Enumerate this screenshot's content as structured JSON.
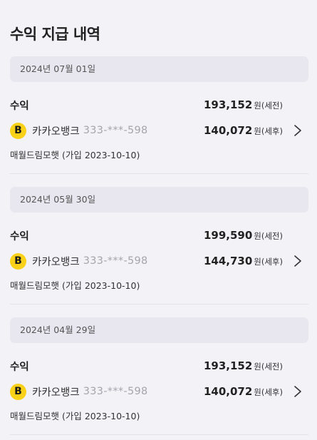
{
  "header": {
    "title": "수익 지급 내역"
  },
  "entries": [
    {
      "date": "2024년 07월 01일",
      "income_label": "수익",
      "pretax_amount": "193,152",
      "pretax_unit": "원(세전)",
      "bank_logo_letter": "B",
      "bank_name": "카카오뱅크",
      "account": "333-***-598",
      "posttax_amount": "140,072",
      "posttax_unit": "원(세후)",
      "plan": "매월드림모햇 (가입 2023-10-10)"
    },
    {
      "date": "2024년 05월 30일",
      "income_label": "수익",
      "pretax_amount": "199,590",
      "pretax_unit": "원(세전)",
      "bank_logo_letter": "B",
      "bank_name": "카카오뱅크",
      "account": "333-***-598",
      "posttax_amount": "144,730",
      "posttax_unit": "원(세후)",
      "plan": "매월드림모햇 (가입 2023-10-10)"
    },
    {
      "date": "2024년 04월 29일",
      "income_label": "수익",
      "pretax_amount": "193,152",
      "pretax_unit": "원(세전)",
      "bank_logo_letter": "B",
      "bank_name": "카카오뱅크",
      "account": "333-***-598",
      "posttax_amount": "140,072",
      "posttax_unit": "원(세후)",
      "plan": "매월드림모햇 (가입 2023-10-10)"
    }
  ],
  "icons": {
    "chevron": "chevron-right-icon",
    "bank_logo": "kakaobank-logo"
  },
  "colors": {
    "background": "#f3f2f7",
    "date_bar": "#e8e7ef",
    "bank_logo": "#f8d118",
    "account_text": "#a5a5ad"
  }
}
